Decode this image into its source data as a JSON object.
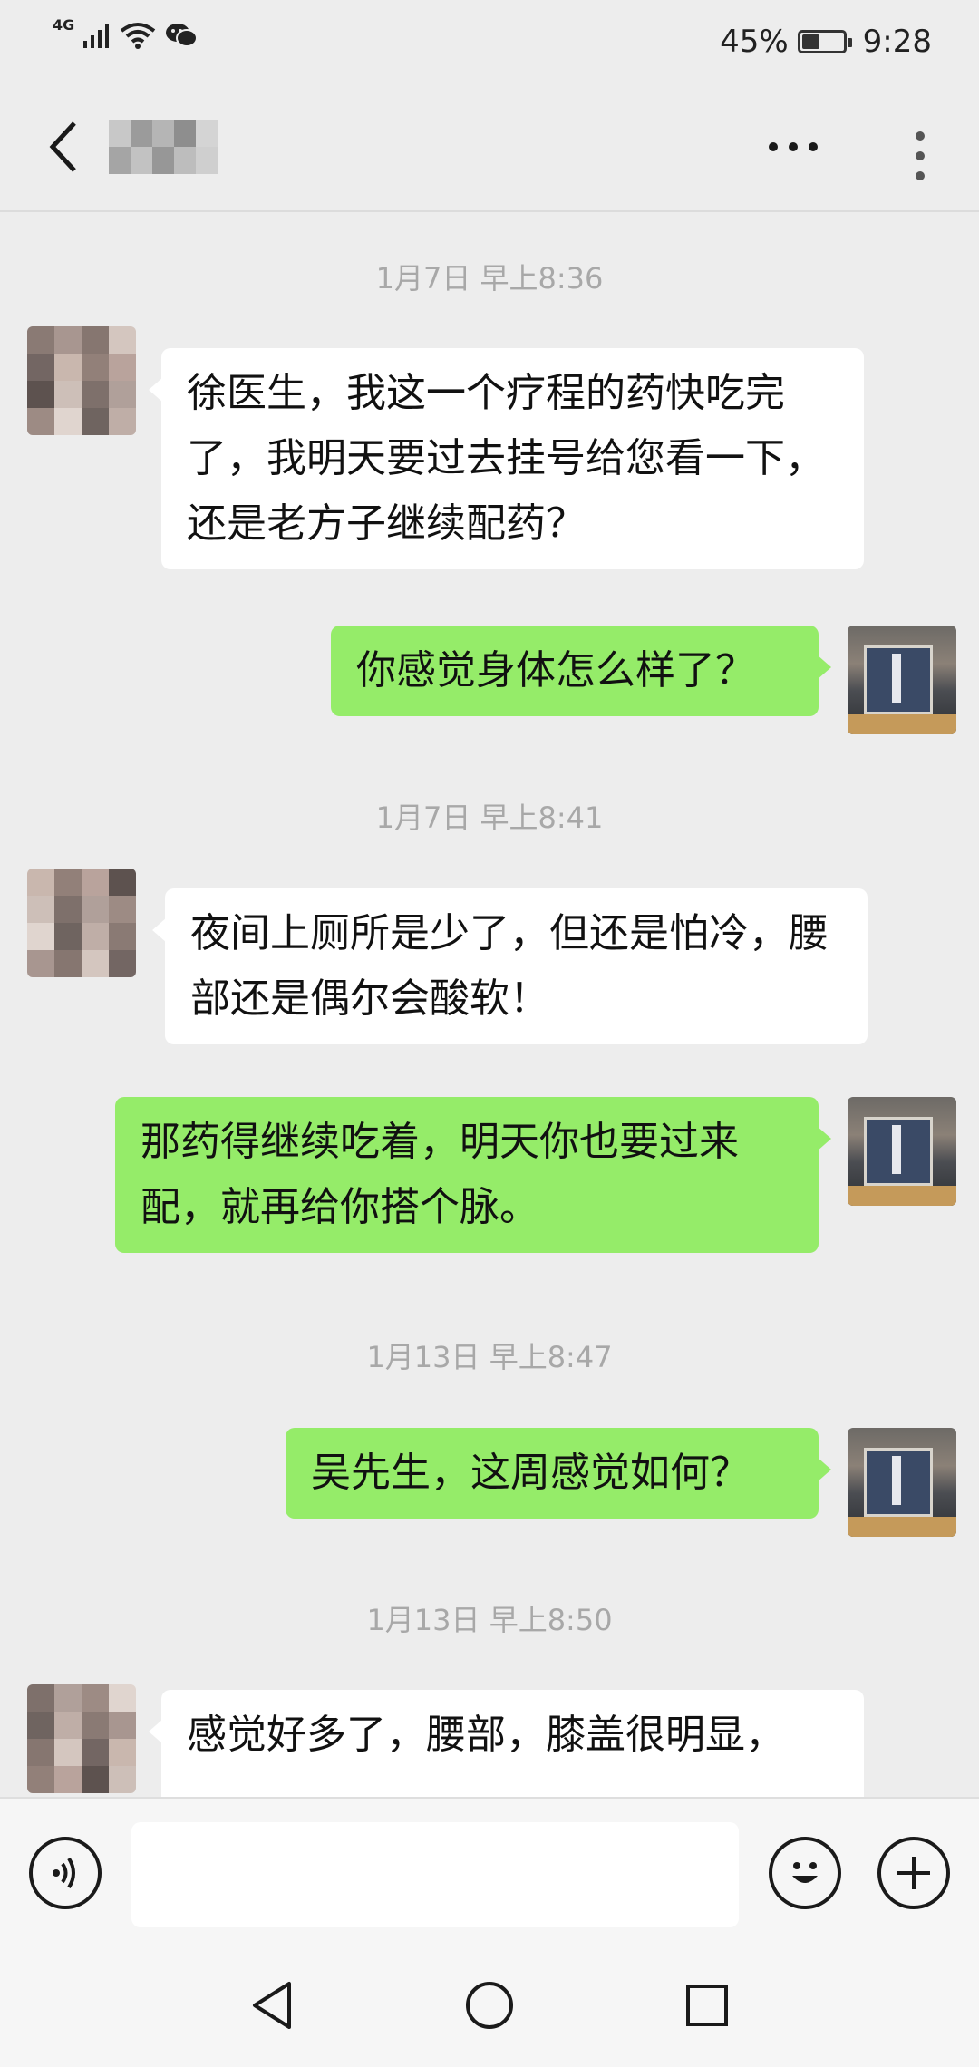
{
  "status_bar": {
    "network": "4G",
    "battery_percent_text": "45%",
    "battery_level": 0.45,
    "time": "9:28"
  },
  "title_bar": {
    "chat_name": "",
    "more_icon": "more-horizontal-icon",
    "menu_icon": "more-vertical-icon"
  },
  "messages": [
    {
      "type": "timestamp",
      "text": "1月7日 早上8:36"
    },
    {
      "type": "received",
      "text": "徐医生，我这一个疗程的药快吃完了，我明天要过去挂号给您看一下，还是老方子继续配药？"
    },
    {
      "type": "sent",
      "text": "你感觉身体怎么样了？"
    },
    {
      "type": "timestamp",
      "text": "1月7日 早上8:41"
    },
    {
      "type": "received",
      "text": "夜间上厕所是少了，但还是怕冷，腰部还是偶尔会酸软！"
    },
    {
      "type": "sent",
      "text": "那药得继续吃着，明天你也要过来配，就再给你搭个脉。"
    },
    {
      "type": "timestamp",
      "text": "1月13日 早上8:47"
    },
    {
      "type": "sent",
      "text": "吴先生，这周感觉如何？"
    },
    {
      "type": "timestamp",
      "text": "1月13日 早上8:50"
    },
    {
      "type": "received",
      "text": "感觉好多了，腰部，膝盖很明显，"
    }
  ],
  "input_bar": {
    "voice_icon": "voice-icon",
    "input_value": "",
    "emoji_icon": "emoji-icon",
    "add_icon": "plus-icon"
  },
  "nav_bar": {
    "back_icon": "triangle-back-icon",
    "home_icon": "circle-home-icon",
    "recents_icon": "square-recents-icon"
  },
  "colors": {
    "background": "#ededed",
    "sent_bubble": "#95ec69",
    "received_bubble": "#ffffff",
    "timestamp": "#a8a8a8"
  }
}
